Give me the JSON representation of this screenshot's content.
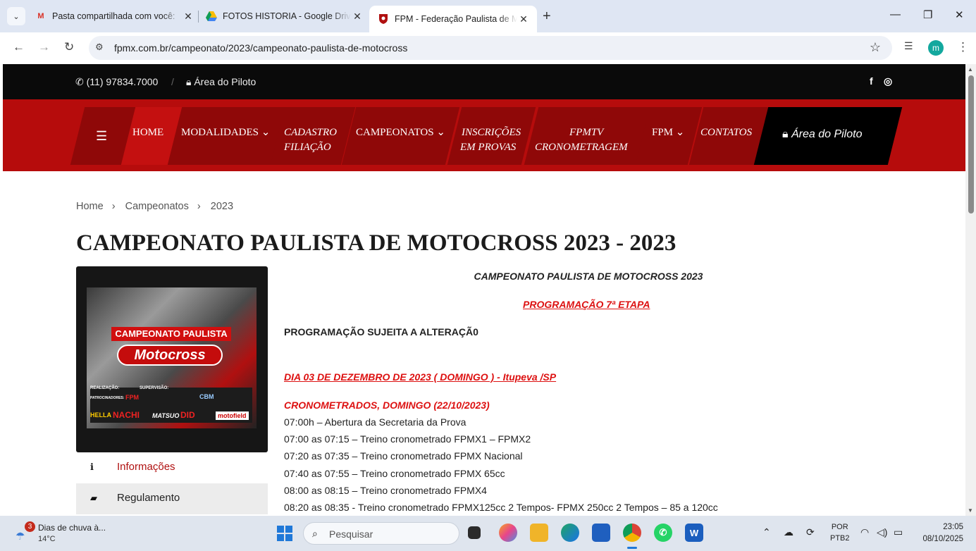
{
  "browser": {
    "tabs": [
      {
        "title": "Pasta compartilhada com você: ",
        "favicon": "gmail-icon"
      },
      {
        "title": "FOTOS HISTORIA - Google Drive",
        "favicon": "google-drive-icon"
      },
      {
        "title": "FPM - Federação Paulista de Motociclismo",
        "favicon": "fpm-shield-icon"
      }
    ],
    "url": "fpmx.com.br/campeonato/2023/campeonato-paulista-de-motocross",
    "profile_initial": "m"
  },
  "topbar": {
    "phone": "(11) 97834.7000",
    "separator": "/",
    "pilot_area": "Área do Piloto",
    "facebook": "f",
    "instagram": "◎"
  },
  "nav": {
    "home": "HOME",
    "modalidades": "MODALIDADES ⌄",
    "cadastro_1": "CADASTRO",
    "cadastro_2": "FILIAÇÃO",
    "campeonatos": "CAMPEONATOS ⌄",
    "inscricoes_1": "INSCRIÇÕES",
    "inscricoes_2": "EM PROVAS",
    "fpmtv_1": "FPMTV",
    "fpmtv_2": "CRONOMETRAGEM",
    "fpm": "FPM ⌄",
    "contatos": "CONTATOS",
    "pilot_area": "Área do Piloto"
  },
  "breadcrumb": [
    "Home",
    "Campeonatos",
    "2023"
  ],
  "page_title": "CAMPEONATO PAULISTA DE MOTOCROSS 2023 - 2023",
  "poster": {
    "title": "CAMPEONATO PAULISTA",
    "logo": "Motocross",
    "sponsors": [
      "REALIZAÇÃO:",
      "SUPERVISÃO:",
      "PATROCINADORES:",
      "FPM",
      "CBM",
      "HELLA",
      "NACHI",
      "MATSUO",
      "DID",
      "motofield"
    ]
  },
  "side_menu": [
    {
      "label": "Informações",
      "icon": "info-icon"
    },
    {
      "label": "Regulamento",
      "icon": "book-icon"
    }
  ],
  "content": {
    "heading": "CAMPEONATO PAULISTA DE MOTOCROSS 2023",
    "programacao": "PROGRAMAÇÃO  7ª ETAPA",
    "notice": "PROGRAMAÇÃO SUJEITA A ALTERAÇÃ0",
    "date_line": "DIA 03 DE DEZEMBRO DE 2023 ( DOMINGO )  - Itupeva /SP",
    "section": "CRONOMETRADOS, DOMINGO  (22/10/2023)",
    "schedule": [
      "07:00h – Abertura da Secretaria da Prova",
      "07:00 as 07:15 – Treino cronometrado FPMX1 – FPMX2",
      "07:20 as 07:35 – Treino cronometrado FPMX Nacional",
      "07:40 as 07:55 – Treino cronometrado FPMX 65cc",
      "08:00 as 08:15 – Treino cronometrado FPMX4",
      "08:20 as 08:35 -  Treino cronometrado FPMX125cc 2 Tempos- FPMX 250cc 2 Tempos – 85 a 120cc"
    ]
  },
  "taskbar": {
    "weather_badge": "3",
    "weather_title": "Dias de chuva à...",
    "weather_temp": "14°C",
    "search_placeholder": "Pesquisar",
    "lang_1": "POR",
    "lang_2": "PTB2",
    "time": "23:05",
    "date": "08/10/2025"
  },
  "colors": {
    "nav_red": "#b60c0c",
    "nav_dark_red": "#8f0808",
    "link_red": "#d11111",
    "topbar": "#0a0a0a"
  }
}
